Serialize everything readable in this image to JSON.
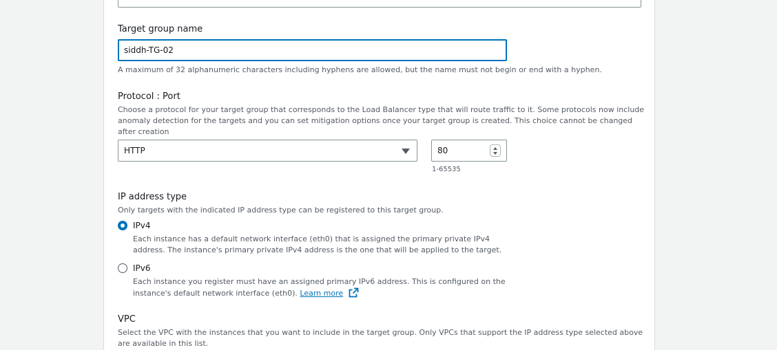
{
  "target_group_name": {
    "label": "Target group name",
    "value": "siddh-TG-02",
    "hint": "A maximum of 32 alphanumeric characters including hyphens are allowed, but the name must not begin or end with a hyphen."
  },
  "protocol_port": {
    "label": "Protocol : Port",
    "description_lines": [
      "Choose a protocol for your target group that corresponds to the Load Balancer type that will route traffic to it. Some protocols now include",
      "anomaly detection for the targets and you can set mitigation options once your target group is created. This choice cannot be changed",
      "after creation"
    ],
    "protocol": "HTTP",
    "port": "80",
    "port_hint": "1-65535"
  },
  "ip_address_type": {
    "label": "IP address type",
    "description": "Only targets with the indicated IP address type can be registered to this target group.",
    "options": [
      {
        "label": "IPv4",
        "selected": true,
        "desc_lines": [
          "Each instance has a default network interface (eth0) that is assigned the primary private IPv4",
          "address. The instance's primary private IPv4 address is the one that will be applied to the target."
        ]
      },
      {
        "label": "IPv6",
        "selected": false,
        "desc_lines": [
          "Each instance you register must have an assigned primary IPv6 address. This is configured on the",
          "instance's default network interface (eth0)."
        ],
        "link_text": "Learn more"
      }
    ]
  },
  "vpc": {
    "label": "VPC",
    "description_lines": [
      "Select the VPC with the instances that you want to include in the target group. Only VPCs that support the IP address type selected above",
      "are available in this list."
    ]
  },
  "colors": {
    "accent": "#0073bb",
    "text": "#16191f",
    "muted": "#545b64",
    "border": "#879596"
  },
  "icons": {
    "dropdown": "caret-down-icon",
    "stepper": "spinner-icon",
    "external_link": "external-link-icon"
  }
}
